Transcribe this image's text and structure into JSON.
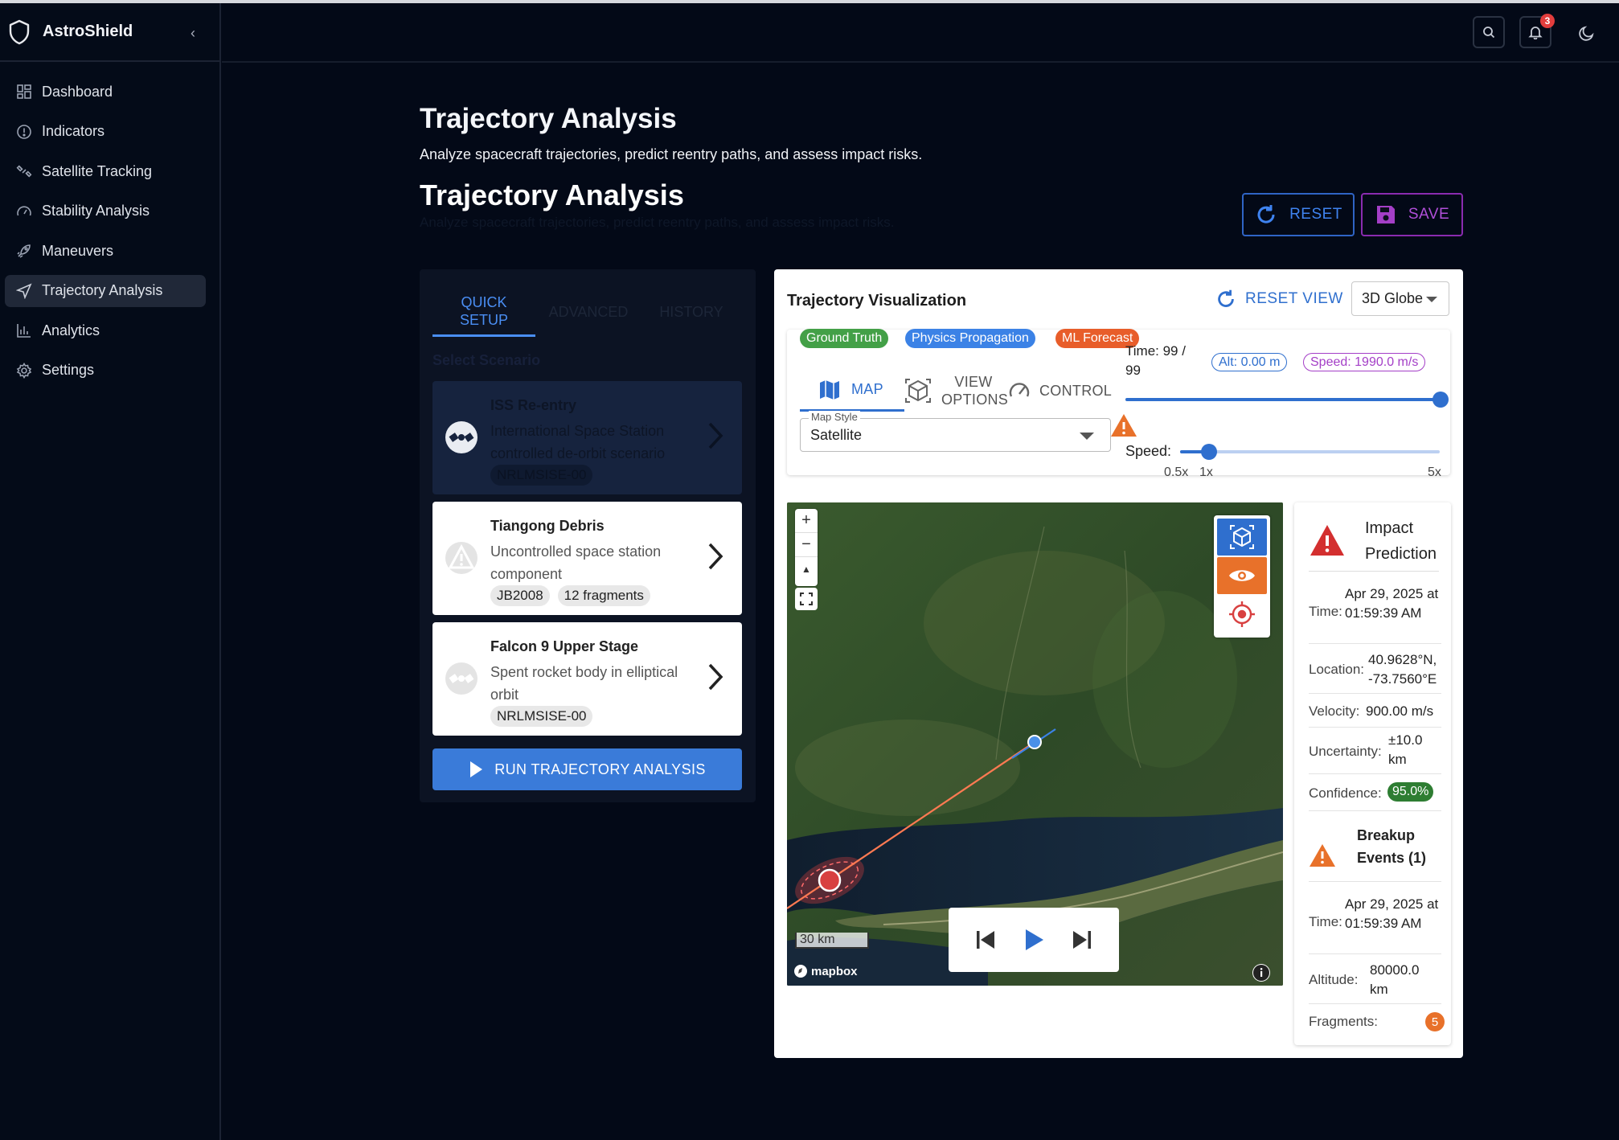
{
  "app": {
    "name": "AstroShield"
  },
  "sidebar": {
    "items": [
      {
        "label": "Dashboard",
        "icon": "dashboard-icon"
      },
      {
        "label": "Indicators",
        "icon": "alert-circle-icon"
      },
      {
        "label": "Satellite Tracking",
        "icon": "satellite-icon"
      },
      {
        "label": "Stability Analysis",
        "icon": "gauge-icon"
      },
      {
        "label": "Maneuvers",
        "icon": "rocket-icon"
      },
      {
        "label": "Trajectory Analysis",
        "icon": "send-icon",
        "active": true
      },
      {
        "label": "Analytics",
        "icon": "bar-chart-icon"
      },
      {
        "label": "Settings",
        "icon": "gear-icon"
      }
    ]
  },
  "header": {
    "notification_count": "3"
  },
  "page": {
    "title": "Trajectory Analysis",
    "subtitle": "Analyze spacecraft trajectories, predict reentry paths, and assess impact risks.",
    "section_title": "Trajectory Analysis",
    "section_subtitle": "Analyze spacecraft trajectories, predict reentry paths, and assess impact risks."
  },
  "actions": {
    "reset": "RESET",
    "save": "SAVE"
  },
  "left_panel": {
    "tabs": [
      "QUICK SETUP",
      "ADVANCED",
      "HISTORY"
    ],
    "select_label": "Select Scenario",
    "scenarios": [
      {
        "title": "ISS Re-entry",
        "description": "International Space Station controlled de-orbit scenario",
        "tags": [
          "NRLMSISE-00"
        ],
        "selected": true
      },
      {
        "title": "Tiangong Debris",
        "description": "Uncontrolled space station component",
        "tags": [
          "JB2008",
          "12 fragments"
        ]
      },
      {
        "title": "Falcon 9 Upper Stage",
        "description": "Spent rocket body in elliptical orbit",
        "tags": [
          "NRLMSISE-00"
        ]
      }
    ],
    "run_label": "RUN TRAJECTORY ANALYSIS"
  },
  "viz": {
    "title": "Trajectory Visualization",
    "reset_view": "RESET VIEW",
    "view_mode": "3D Globe",
    "legend": [
      {
        "label": "Ground Truth",
        "color": "#43a047"
      },
      {
        "label": "Physics Propagation",
        "color": "#3b82e6"
      },
      {
        "label": "ML Forecast",
        "color": "#e85d2a"
      }
    ],
    "control_tabs": [
      "MAP",
      "VIEW OPTIONS",
      "CONTROL"
    ],
    "map_style_label": "Map Style",
    "map_style_value": "Satellite",
    "time_label": "Time: 99 / 99",
    "time_progress": 1.0,
    "alt_chip": "Alt: 0.00 m",
    "speed_chip": "Speed: 1990.0 m/s",
    "speed_label": "Speed:",
    "speed_ticks": [
      "0.5x",
      "1x",
      "5x"
    ],
    "speed_value": 1.0,
    "scale_label": "30 km",
    "mapbox_label": "mapbox"
  },
  "impact": {
    "title": "Impact Prediction",
    "rows": [
      {
        "key": "Time:",
        "value": "Apr 29, 2025 at 01:59:39 AM"
      },
      {
        "key": "Location:",
        "value": "40.9628°N, -73.7560°E"
      },
      {
        "key": "Velocity:",
        "value": "900.00 m/s"
      },
      {
        "key": "Uncertainty:",
        "value": "±10.0 km"
      },
      {
        "key": "Confidence:",
        "value": "95.0%"
      }
    ],
    "breakup_title": "Breakup Events (1)",
    "breakup_rows": [
      {
        "key": "Time:",
        "value": "Apr 29, 2025 at 01:59:39 AM"
      },
      {
        "key": "Altitude:",
        "value": "80000.0 km"
      },
      {
        "key": "Fragments:",
        "value": "5"
      }
    ]
  }
}
